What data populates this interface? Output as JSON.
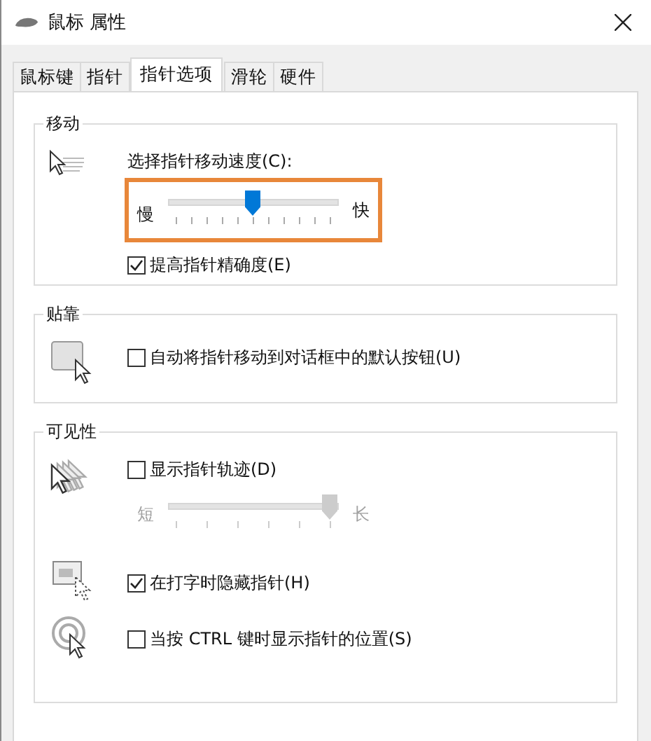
{
  "window": {
    "title": "鼠标 属性"
  },
  "tabs": [
    {
      "label": "鼠标键",
      "selected": false
    },
    {
      "label": "指针",
      "selected": false
    },
    {
      "label": "指针选项",
      "selected": true
    },
    {
      "label": "滑轮",
      "selected": false
    },
    {
      "label": "硬件",
      "selected": false
    }
  ],
  "motion": {
    "title": "移动",
    "speed_label": "选择指针移动速度(C):",
    "speed": {
      "min_label": "慢",
      "max_label": "快",
      "level": 0.5,
      "highlighted": true,
      "disabled": false
    },
    "precision": {
      "label": "提高指针精确度(E)",
      "checked": true
    }
  },
  "snap": {
    "title": "贴靠",
    "option": {
      "label": "自动将指针移动到对话框中的默认按钮(U)",
      "checked": false
    }
  },
  "visibility": {
    "title": "可见性",
    "trails": {
      "label": "显示指针轨迹(D)",
      "checked": false
    },
    "trail_length": {
      "min_label": "短",
      "max_label": "长",
      "level": 1,
      "highlighted": false,
      "disabled": true
    },
    "hide_typing": {
      "label": "在打字时隐藏指针(H)",
      "checked": true
    },
    "show_ctrl": {
      "label": "当按 CTRL 键时显示指针的位置(S)",
      "checked": false
    }
  }
}
